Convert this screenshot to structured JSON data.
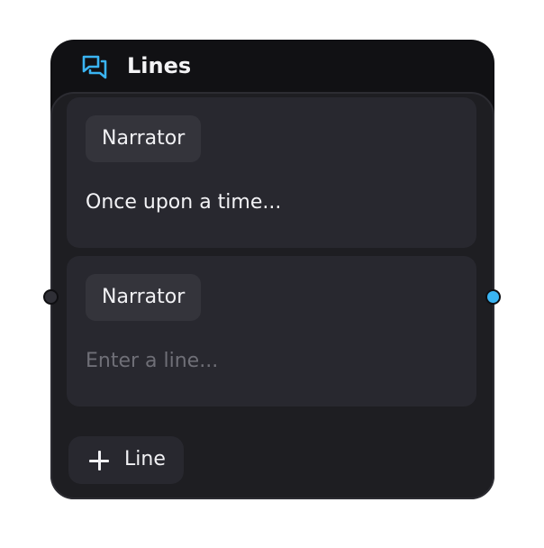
{
  "node": {
    "title": "Lines",
    "icon": "chat-bubbles-icon",
    "accent_color": "#3ab4f2"
  },
  "lines": [
    {
      "speaker": "Narrator",
      "text": "Once upon a time...",
      "placeholder": "Enter a line..."
    },
    {
      "speaker": "Narrator",
      "text": "",
      "placeholder": "Enter a line..."
    }
  ],
  "add_line_button": {
    "label": "Line",
    "icon": "plus-icon"
  },
  "ports": {
    "input": {
      "color": "#2f2f36"
    },
    "output": {
      "color": "#3ab4f2"
    }
  }
}
